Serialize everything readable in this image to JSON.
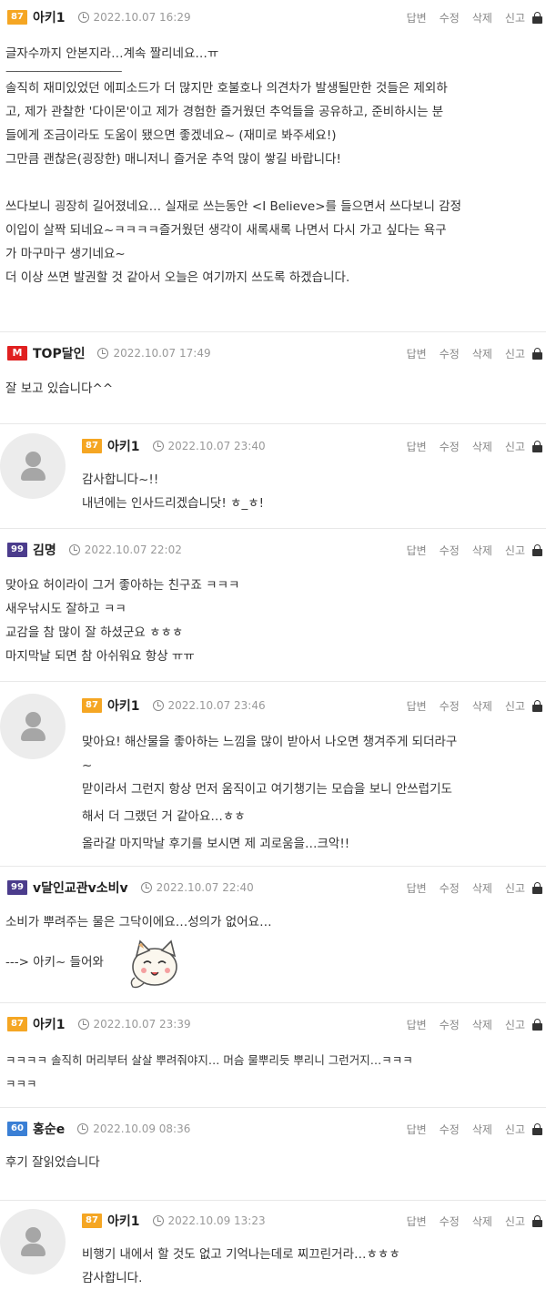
{
  "actions": {
    "reply": "답변",
    "edit": "수정",
    "delete": "삭제",
    "report": "신고"
  },
  "comments": [
    {
      "level": "87",
      "nick": "아키1",
      "time": "2022.10.07 16:29",
      "lines": [
        "글자수까지 안본지라…계속 짤리네요…ㅠ",
        "———————————",
        "솔직히 재미있었던 에피소드가 더 많지만 호불호나 의견차가 발생될만한 것들은 제외하",
        "고, 제가 관찰한 '다이몬'이고 제가 경험한 즐거웠던 추억들을 공유하고, 준비하시는 분",
        "들에게 조금이라도 도움이 됐으면 좋겠네요~ (재미로 봐주세요!)",
        "그만큼 괜찮은(굉장한) 매니저니 즐거운 추억 많이 쌓길 바랍니다!",
        "",
        "쓰다보니 굉장히 길어졌네요… 실재로 쓰는동안 <I Believe>를 들으면서 쓰다보니 감정",
        "이입이 살짝 되네요~ㅋㅋㅋㅋ즐거웠던 생각이 새록새록 나면서 다시 가고 싶다는 욕구",
        "가 마구마구 생기네요~",
        "더 이상 쓰면 발권할 것 같아서 오늘은 여기까지 쓰도록 하겠습니다."
      ]
    },
    {
      "level": "M",
      "nick": "TOP달인",
      "time": "2022.10.07 17:49",
      "lines": [
        "잘 보고 있습니다^^"
      ]
    },
    {
      "level": "87",
      "nick": "아키1",
      "time": "2022.10.07 23:40",
      "lines": [
        "감사합니다~!!",
        "내년에는 인사드리겠습니닷! ㅎ_ㅎ!"
      ]
    },
    {
      "level": "99",
      "nick": "김명",
      "time": "2022.10.07 22:02",
      "lines": [
        "맞아요 허이라이 그거 좋아하는 친구죠 ㅋㅋㅋ",
        "새우낚시도 잘하고 ㅋㅋ",
        "교감을 참 많이 잘 하셨군요 ㅎㅎㅎ",
        "마지막날 되면 참 아쉬워요 항상 ㅠㅠ"
      ]
    },
    {
      "level": "87",
      "nick": "아키1",
      "time": "2022.10.07 23:46",
      "lines": [
        "맞아요! 해산물을 좋아하는 느낌을 많이 받아서 나오면 챙겨주게 되더라구",
        "~",
        "맏이라서 그런지 항상 먼저 움직이고 여기챙기는 모습을 보니 안쓰럽기도",
        "해서 더 그랬던 거 같아요…ㅎㅎ",
        "올라갈 마지막날 후기를 보시면 제 괴로움을…크악!!"
      ]
    },
    {
      "level": "99",
      "nick": "v달인교관v소비v",
      "time": "2022.10.07 22:40",
      "lines": [
        "소비가 뿌려주는 물은 그닥이에요…성의가 없어요…",
        "",
        "---> 아키~ 들어와"
      ]
    },
    {
      "level": "87",
      "nick": "아키1",
      "time": "2022.10.07 23:39",
      "lines": [
        "ㅋㅋㅋㅋ 솔직히 머리부터 살살 뿌려줘야지… 머슴 물뿌리듯 뿌리니 그런거지…ㅋㅋㅋ",
        "ㅋㅋㅋ"
      ]
    },
    {
      "level": "60",
      "nick": "홍순e",
      "time": "2022.10.09 08:36",
      "lines": [
        "후기 잘읽었습니다"
      ]
    },
    {
      "level": "87",
      "nick": "아키1",
      "time": "2022.10.09 13:23",
      "lines": [
        "비행기 내에서 할 것도 없고 기억나는데로 찌끄린거라…ㅎㅎㅎ",
        "감사합니다."
      ]
    }
  ]
}
